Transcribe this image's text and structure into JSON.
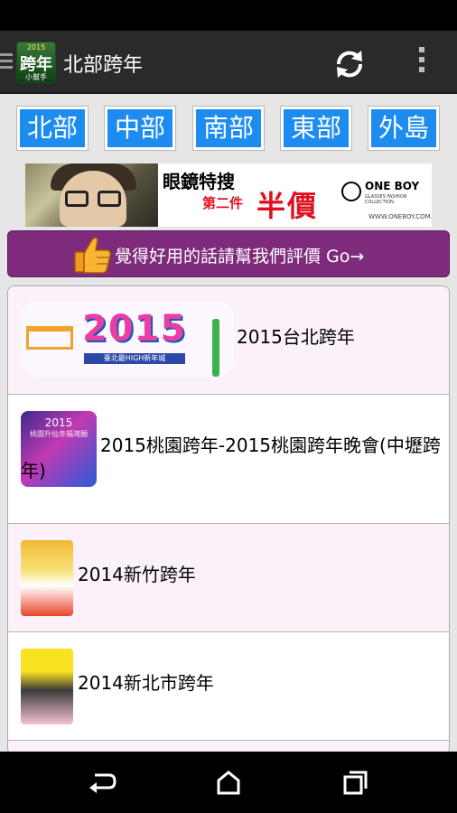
{
  "action_bar": {
    "title": "北部跨年",
    "logo": {
      "year": "2015",
      "main": "跨年",
      "sub": "小幫手"
    },
    "refresh_icon": "refresh-icon",
    "overflow_icon": "overflow-menu-icon",
    "drawer_icon": "drawer-menu-icon"
  },
  "regions": {
    "north": "北部",
    "central": "中部",
    "south": "南部",
    "east": "東部",
    "islands": "外島"
  },
  "ad": {
    "line1": "眼鏡特搜",
    "line2": "第二件",
    "line3": "半價",
    "brand": "ONE BOY",
    "brand_sub": "GLASSES FASHION COLLECTION",
    "url": "WWW.ONEBOY.COM.TW"
  },
  "rate": {
    "text": "覺得好用的話請幫我們評價 Go→",
    "icon": "thumbs-up-icon"
  },
  "events": [
    {
      "title": "2015台北跨年",
      "thumb_text": "2015",
      "thumb_sub": "臺北最HIGH新年城"
    },
    {
      "title": "2015桃園跨年-2015桃園跨年晚會(中壢跨年)",
      "thumb_text": "2015",
      "thumb_sub": "桃園升仙幸福灣願"
    },
    {
      "title": "2014新竹跨年"
    },
    {
      "title": "2014新北市跨年"
    }
  ],
  "colors": {
    "region_button": "#1d8cf0",
    "rate_bar": "#7e2b7c",
    "action_bar": "#2a2a2a",
    "list_highlight": "#fbf1fa",
    "ad_red": "#e01020"
  },
  "nav": {
    "back_icon": "back-icon",
    "home_icon": "home-icon",
    "recents_icon": "recents-icon"
  }
}
